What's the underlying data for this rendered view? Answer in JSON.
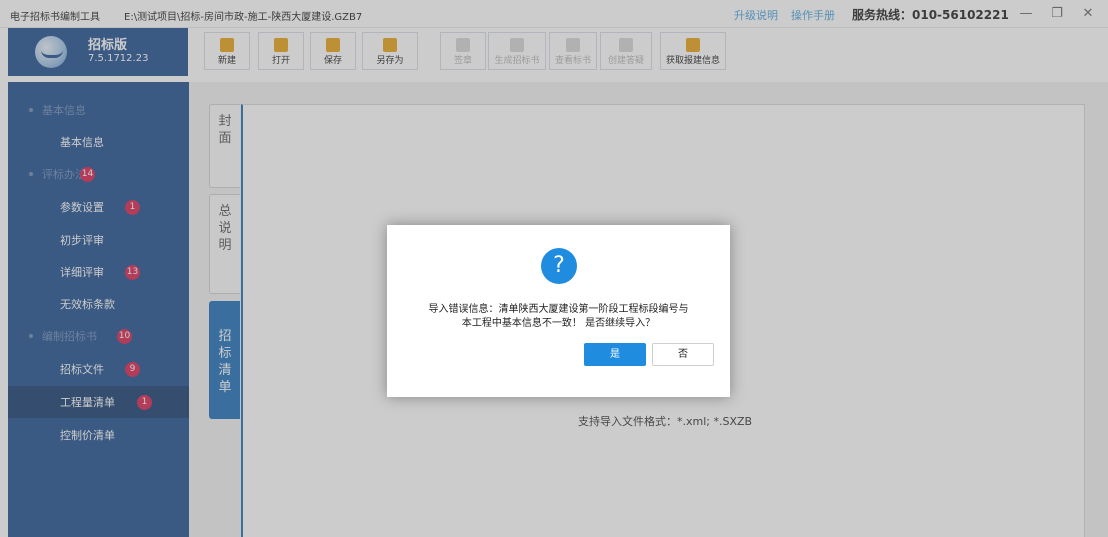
{
  "titlebar": {
    "app_name": "电子招标书编制工具",
    "file_path": "E:\\测试项目\\招标-房间市政-施工-陕西大厦建设.GZB7",
    "upgrade_label": "升级说明",
    "manual_label": "操作手册",
    "hotline": "服务热线：010-56102221",
    "minimize": "—",
    "restore": "❐",
    "close": "✕"
  },
  "logo": {
    "title": "招标版",
    "version": "7.5.1712.23"
  },
  "toolbar": {
    "buttons": [
      {
        "label": "新建",
        "icon": "new-file-icon",
        "color": "#e8a317",
        "enabled": true
      },
      {
        "label": "打开",
        "icon": "folder-open-icon",
        "color": "#e8a317",
        "enabled": true
      },
      {
        "label": "保存",
        "icon": "save-icon",
        "color": "#e8a317",
        "enabled": true
      },
      {
        "label": "另存为",
        "icon": "save-as-icon",
        "color": "#e8a317",
        "enabled": true
      },
      {
        "label": "签章",
        "icon": "seal-icon",
        "color": "#d6d6d6",
        "enabled": false
      },
      {
        "label": "生成招标书",
        "icon": "generate-doc-icon",
        "color": "#d6d6d6",
        "enabled": false
      },
      {
        "label": "查看标书",
        "icon": "view-doc-icon",
        "color": "#d6d6d6",
        "enabled": false
      },
      {
        "label": "创建答疑",
        "icon": "create-qa-icon",
        "color": "#d6d6d6",
        "enabled": false
      },
      {
        "label": "获取报建信息",
        "icon": "fetch-info-icon",
        "color": "#e8a317",
        "enabled": true
      }
    ]
  },
  "sidebar": {
    "items": [
      {
        "label": "基本信息",
        "type": "group",
        "badge": ""
      },
      {
        "label": "基本信息",
        "type": "item",
        "badge": ""
      },
      {
        "label": "评标办法",
        "type": "group",
        "badge": "14"
      },
      {
        "label": "参数设置",
        "type": "item",
        "badge": "1"
      },
      {
        "label": "初步评审",
        "type": "item",
        "badge": ""
      },
      {
        "label": "详细评审",
        "type": "item",
        "badge": "13"
      },
      {
        "label": "无效标条款",
        "type": "item",
        "badge": ""
      },
      {
        "label": "编制招标书",
        "type": "group",
        "badge": "10"
      },
      {
        "label": "招标文件",
        "type": "item",
        "badge": "9"
      },
      {
        "label": "工程量清单",
        "type": "item",
        "badge": "1",
        "active": true
      },
      {
        "label": "控制价清单",
        "type": "item",
        "badge": ""
      }
    ]
  },
  "tabs": [
    {
      "label": "封面"
    },
    {
      "label": "总说明"
    },
    {
      "label": "招标清单",
      "active": true
    }
  ],
  "main": {
    "support_text": "支持导入文件格式：*.xml; *.SXZB"
  },
  "dialog": {
    "icon": "question-icon",
    "icon_glyph": "?",
    "message_line1": "导入错误信息：清单陕西大厦建设第一阶段工程标段编号与",
    "message_line2": "本工程中基本信息不一致！ 是否继续导入？",
    "yes_label": "是",
    "no_label": "否"
  },
  "colors": {
    "sidebar_bg": "#1f4f8f",
    "accent_blue": "#1f8ce0",
    "badge_red": "#d9234f",
    "link_blue": "#4aa3df"
  }
}
